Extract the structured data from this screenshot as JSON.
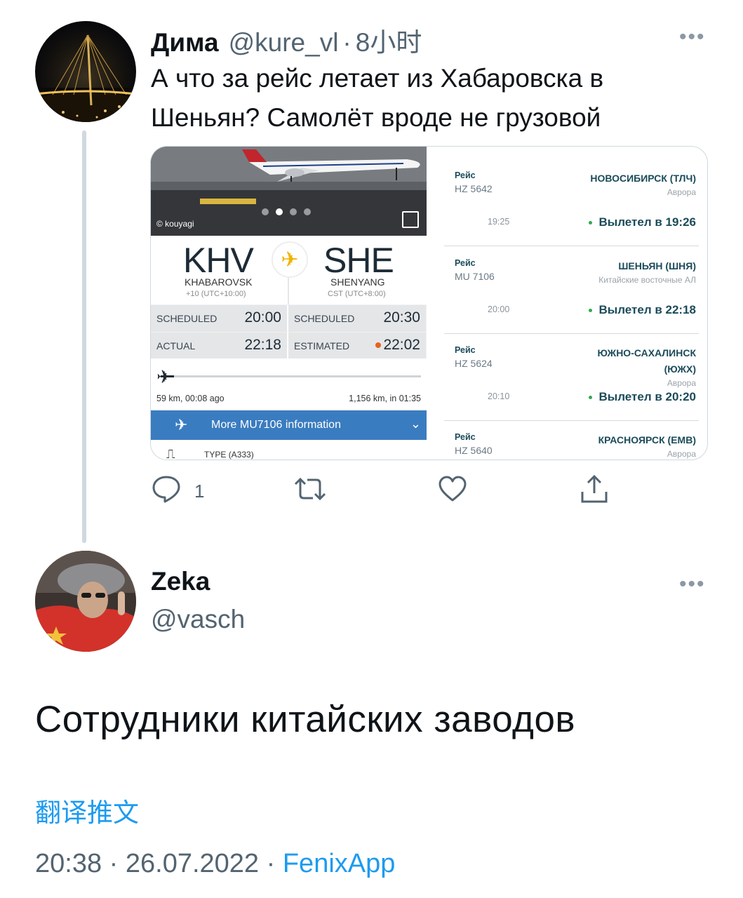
{
  "tweet1": {
    "name": "Дима",
    "handle": "@kure_vl",
    "separator": "·",
    "time": "8小时",
    "more": "•••",
    "text": "А что за рейс летает из Хабаровска в Шеньян? Самолёт вроде не грузовой",
    "actions": {
      "reply_count": "1"
    }
  },
  "flight_card": {
    "photo_credit": "© kouyagi",
    "origin": {
      "code": "KHV",
      "city": "KHABAROVSK",
      "tz": "+10 (UTC+10:00)"
    },
    "destination": {
      "code": "SHE",
      "city": "SHENYANG",
      "tz": "CST (UTC+8:00)"
    },
    "scheduled_label": "SCHEDULED",
    "scheduled_dep": "20:00",
    "scheduled_arr": "20:30",
    "actual_label": "ACTUAL",
    "actual_dep": "22:18",
    "estimated_label": "ESTIMATED",
    "estimated_arr": "22:02",
    "progress": {
      "fraction": 0.05,
      "left": "59 km, 00:08 ago",
      "right": "1,156 km, in 01:35"
    },
    "more_info": "More MU7106 information",
    "type_label": "TYPE",
    "type_value": "(A333)"
  },
  "departures": [
    {
      "label": "Рейс",
      "number": "HZ 5642",
      "time": "19:25",
      "destination": "НОВОСИБИРСК (ТЛЧ)",
      "airline": "Аврора",
      "status": "Вылетел в 19:26"
    },
    {
      "label": "Рейс",
      "number": "MU 7106",
      "time": "20:00",
      "destination": "ШЕНЬЯН (ШНЯ)",
      "airline": "Китайские восточные АЛ",
      "status": "Вылетел в 22:18"
    },
    {
      "label": "Рейс",
      "number": "HZ 5624",
      "time": "20:10",
      "destination_line1": "ЮЖНО-САХАЛИНСК",
      "destination_line2": "(ЮЖХ)",
      "airline": "Аврора",
      "status": "Вылетел в 20:20"
    },
    {
      "label": "Рейс",
      "number": "HZ 5640",
      "destination": "КРАСНОЯРСК (ЕМВ)",
      "airline": "Аврора"
    }
  ],
  "tweet2": {
    "name": "Zeka",
    "handle": "@vasch",
    "more": "•••",
    "text": "Сотрудники китайских заводов",
    "translate": "翻译推文",
    "time": "20:38",
    "separator": "·",
    "date": "26.07.2022",
    "app": "FenixApp"
  },
  "colors": {
    "link": "#1d9bf0",
    "secondary": "#536471",
    "info_bar": "#3a7cc0",
    "departed_dot": "#2eaa4f",
    "estimated_dot": "#e8621b"
  }
}
